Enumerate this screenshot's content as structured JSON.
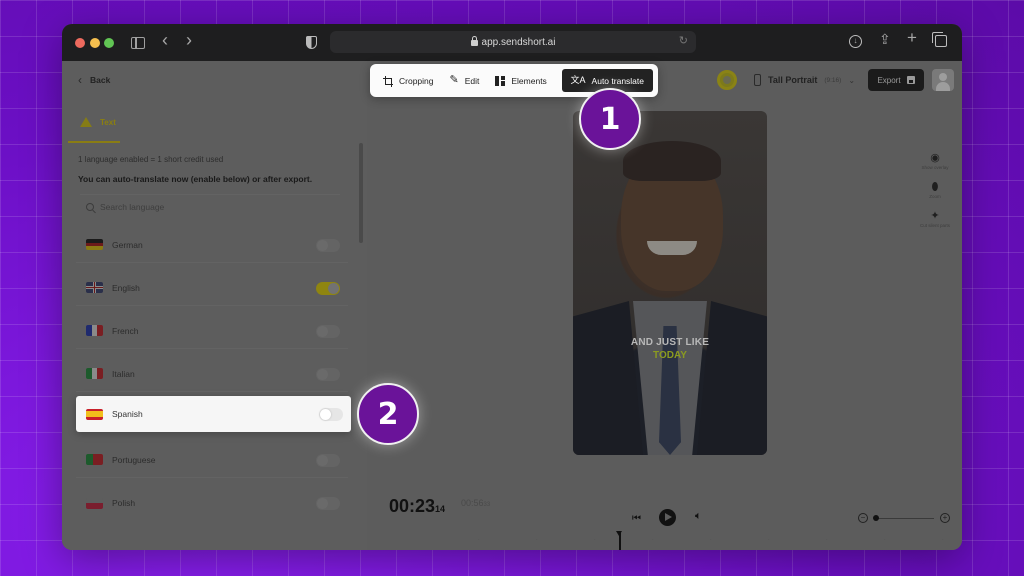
{
  "browser": {
    "url": "app.sendshort.ai",
    "icons": [
      "sidebar-toggle-icon",
      "back-icon",
      "forward-icon",
      "shield-icon",
      "lock-icon",
      "reload-icon",
      "download-icon",
      "share-icon",
      "new-tab-icon",
      "tabs-overview-icon"
    ]
  },
  "left_panel": {
    "back_label": "Back",
    "tab_label": "Text",
    "info_line1": "1 language enabled = 1 short credit used",
    "info_line2": "You can auto-translate now (enable below) or after export.",
    "search_placeholder": "Search language",
    "languages": [
      {
        "name": "German",
        "enabled": false
      },
      {
        "name": "English",
        "enabled": true
      },
      {
        "name": "French",
        "enabled": false
      },
      {
        "name": "Italian",
        "enabled": false
      },
      {
        "name": "Spanish",
        "enabled": false,
        "highlighted": true
      },
      {
        "name": "Portuguese",
        "enabled": false
      },
      {
        "name": "Polish",
        "enabled": false
      }
    ]
  },
  "toolbar": {
    "items": [
      {
        "label": "Cropping",
        "icon": "crop-icon"
      },
      {
        "label": "Edit",
        "icon": "pencil-icon"
      },
      {
        "label": "Elements",
        "icon": "layout-icon"
      },
      {
        "label": "Auto translate",
        "icon": "translate-icon",
        "active": true
      }
    ]
  },
  "header_right": {
    "format_label": "Tall Portrait",
    "format_ratio": "(9:16)",
    "export_label": "Export"
  },
  "side_tools": [
    {
      "label": "Show overlay",
      "icon": "eye-icon"
    },
    {
      "label": "Zoom",
      "icon": "bandage-icon"
    },
    {
      "label": "Cut silent parts",
      "icon": "sparkle-icon"
    }
  ],
  "video": {
    "caption_line1": "AND JUST LIKE",
    "caption_line2": "TODAY",
    "caption_highlight_color": "#c8e030"
  },
  "timeline": {
    "current_time": "00:23",
    "current_ms": "14",
    "total_time": "00:56",
    "total_ms": "33"
  },
  "annotations": [
    {
      "number": "1",
      "target": "Auto translate"
    },
    {
      "number": "2",
      "target": "Spanish"
    }
  ],
  "colors": {
    "annotation_badge": "#6a1399",
    "background": "#7a12d8",
    "toggle_on": "#d4c400"
  }
}
